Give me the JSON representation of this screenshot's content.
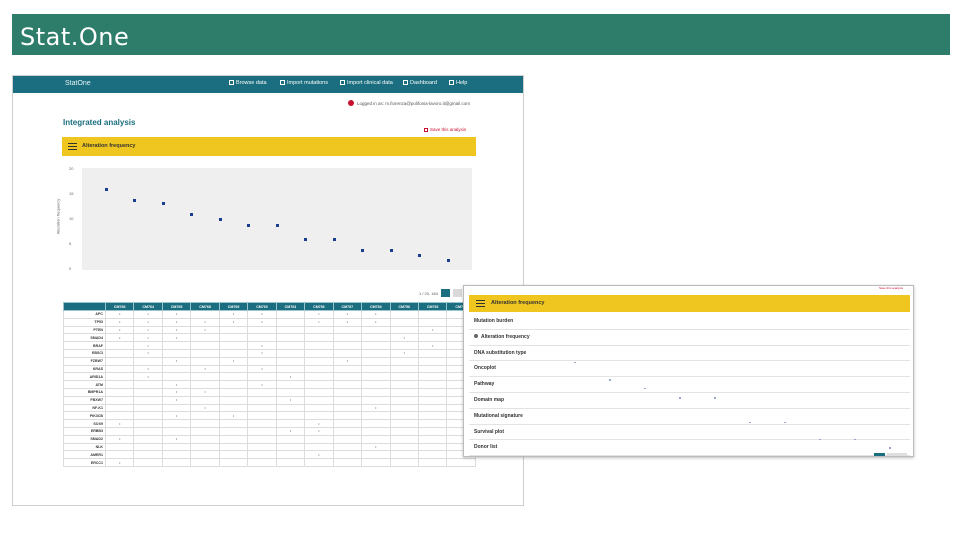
{
  "slide": {
    "title": "Stat.One"
  },
  "app": {
    "brand": "StatOne",
    "nav": [
      "Browse data",
      "Import mutations",
      "Import clinical data",
      "Dashboard",
      "Help"
    ],
    "logged_in": "Logged in as: m.fiorenza@polifonia-lavoro.it@gmail.com",
    "heading": "Integrated analysis",
    "save_link": "Save this analysis",
    "panel_title": "Alteration frequency",
    "y_label": "Alteration frequency",
    "y_ticks": [
      "20",
      "15",
      "10",
      "5",
      "0"
    ],
    "pager": "1 / 20, 164"
  },
  "chart_data": {
    "type": "scatter",
    "x": [
      1,
      2,
      3,
      4,
      5,
      6,
      7,
      8,
      9,
      10,
      11,
      12,
      13
    ],
    "y": [
      15.7,
      13.6,
      13.0,
      10.9,
      9.9,
      8.8,
      8.8,
      5.9,
      5.9,
      3.9,
      3.9,
      2.9,
      1.9
    ],
    "ylim": [
      0,
      20
    ],
    "grid": false
  },
  "table": {
    "columns": [
      "",
      "CM766",
      "CM764",
      "CM765",
      "CM768",
      "CM769",
      "CM760",
      "CM763",
      "CM756",
      "CM757",
      "CM754",
      "CM756",
      "CM752",
      "CM758"
    ],
    "genes": [
      "APC",
      "TP53",
      "PTEN",
      "SMAD4",
      "BRAF",
      "EBSCI",
      "FZBW7",
      "KRAS",
      "ARID1A",
      "ATM",
      "BMPR1A",
      "FBXW7",
      "NF-K1",
      "PIK3CB",
      "SOX9",
      "ERBB3",
      "SMAD2",
      "NLK",
      "AMER1",
      "ERCC1"
    ],
    "marks": [
      [
        1,
        2,
        3,
        5,
        6,
        8,
        9,
        10
      ],
      [
        1,
        2,
        3,
        4,
        5,
        6,
        8,
        9,
        10
      ],
      [
        1,
        2,
        3,
        4,
        12
      ],
      [
        1,
        2,
        3,
        11
      ],
      [
        2,
        6,
        12
      ],
      [
        2,
        6,
        11
      ],
      [
        3,
        5,
        9
      ],
      [
        2,
        4,
        6
      ],
      [
        2,
        7
      ],
      [
        3,
        6
      ],
      [
        3,
        4
      ],
      [
        3,
        7
      ],
      [
        4,
        10
      ],
      [
        3,
        5
      ],
      [
        1,
        8
      ],
      [
        7,
        8
      ],
      [
        1,
        3
      ],
      [
        10
      ],
      [
        8
      ],
      [
        1
      ]
    ]
  },
  "overlay": {
    "red_text": "Save this analysis",
    "panel_title": "Alteration frequency",
    "menu": [
      "Mutation burden",
      "Alteration frequency",
      "DNA substitution type",
      "Oncoplot",
      "Pathway",
      "Domain map",
      "Mutational signature",
      "Survival plot",
      "Donor list"
    ],
    "selected": 1
  },
  "colors": {
    "title_bar": "#2e7d6b",
    "app_nav": "#1a6e7f",
    "panel": "#efc61f",
    "point": "#1a3d8f",
    "save": "#c8102e"
  }
}
